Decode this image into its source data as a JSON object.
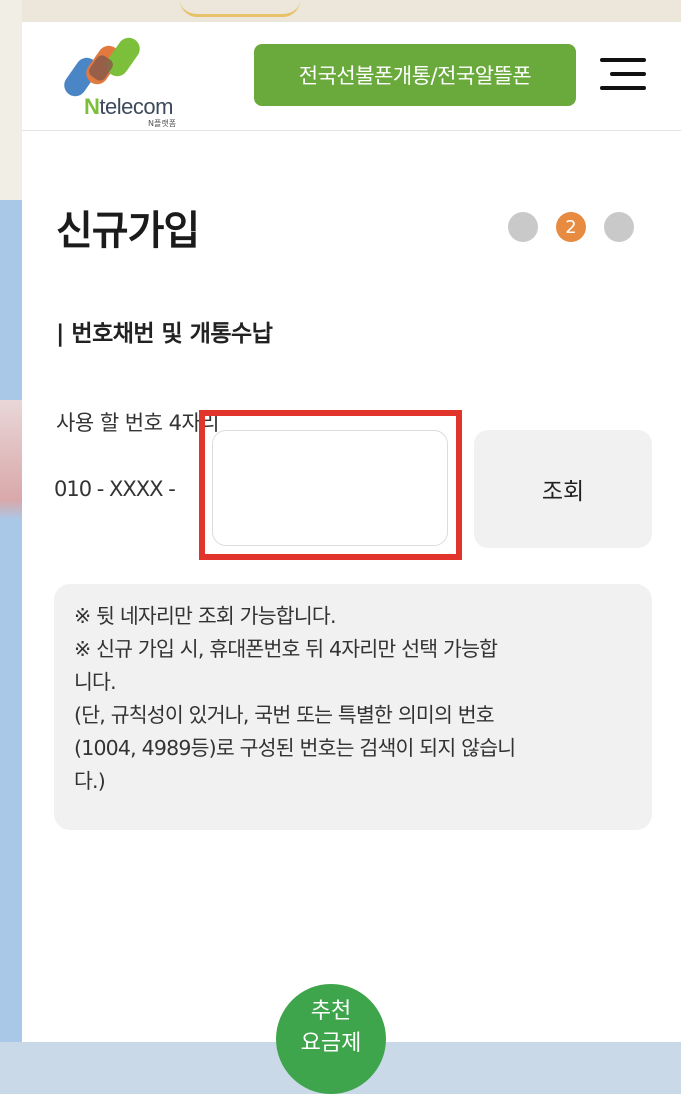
{
  "header": {
    "logo_text_n": "N",
    "logo_text_rest": "telecom",
    "logo_sub": "N플랫폼",
    "promo_label": "전국선불폰개통/전국알뜰폰",
    "menu_icon": "hamburger-menu-icon"
  },
  "page": {
    "title": "신규가입",
    "steps": [
      "",
      "2",
      ""
    ],
    "active_step": 2
  },
  "section": {
    "title": "| 번호채번 및 개통수납",
    "field_label": "사용 할 번호 4자리",
    "prefix": "010 - XXXX -",
    "input_value": "",
    "input_placeholder": "",
    "search_label": "조회"
  },
  "notice": {
    "lines": [
      "※ 뒷 네자리만 조회 가능합니다.",
      "※ 신규 가입 시, 휴대폰번호 뒤 4자리만 선택 가능합",
      "니다.",
      "(단, 규칙성이 있거나, 국번 또는 특별한 의미의 번호",
      "(1004, 4989등)로 구성된 번호는 검색이 되지 않습니",
      "다.)"
    ]
  },
  "fab": {
    "line1": "추천",
    "line2": "요금제"
  },
  "colors": {
    "brand_green": "#6aaa3c",
    "step_active": "#e68b3f",
    "highlight_red": "#e1342a",
    "fab_green": "#3fa54c"
  }
}
